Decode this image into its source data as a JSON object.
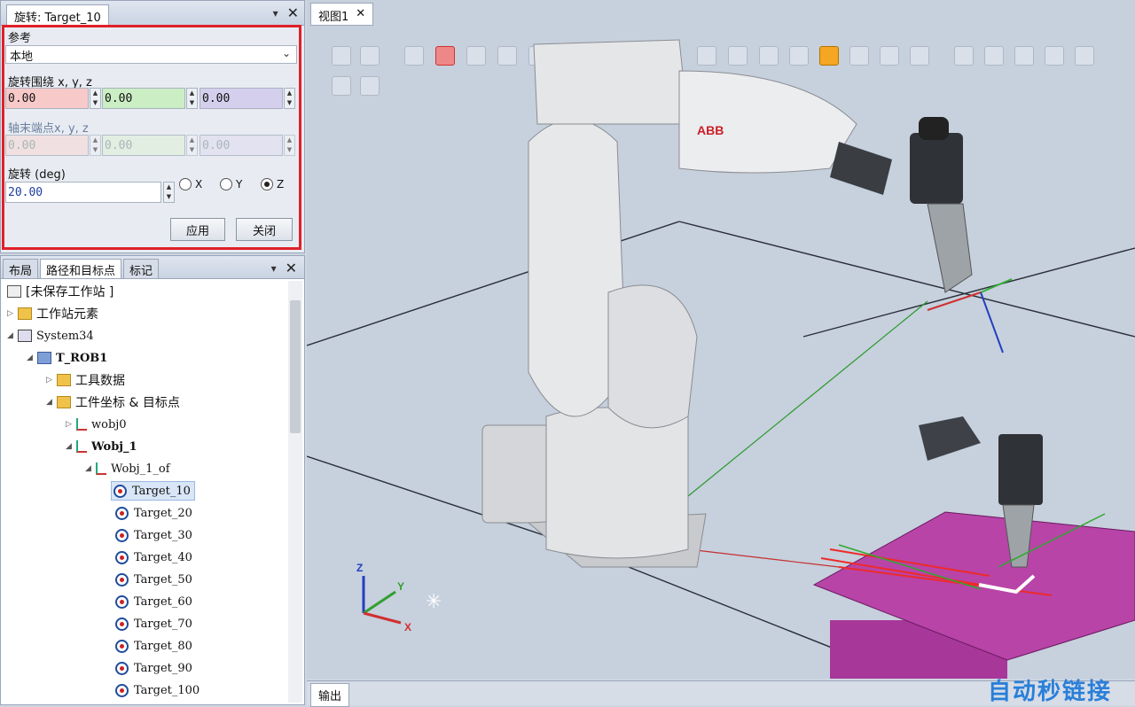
{
  "rotate_panel": {
    "title": "旋转: Target_10",
    "pin": "▾ ⊥",
    "reference_label": "参考",
    "reference_value": "本地",
    "rotate_around_label": "旋转围绕 x, y, z",
    "around_x": "0.00",
    "around_y": "0.00",
    "around_z": "0.00",
    "axis_end_label": "轴末端点x, y, z",
    "end_x": "0.00",
    "end_y": "0.00",
    "end_z": "0.00",
    "rotation_label": "旋转 (deg)",
    "rotation_value": "20.00",
    "radio_x": "X",
    "radio_y": "Y",
    "radio_z": "Z",
    "selected_axis": "Z",
    "apply_label": "应用",
    "close_label": "关闭"
  },
  "tree_panel": {
    "tabs": [
      "布局",
      "路径和目标点",
      "标记"
    ],
    "nodes": {
      "station": "[未保存工作站 ]",
      "station_elements": "工作站元素",
      "system": "System34",
      "task": "T_ROB1",
      "tool_data": "工具数据",
      "wobj_targets": "工件坐标 & 目标点",
      "wobj0": "wobj0",
      "wobj1": "Wobj_1",
      "wobj1_of": "Wobj_1_of"
    },
    "targets": [
      "Target_10",
      "Target_20",
      "Target_30",
      "Target_40",
      "Target_50",
      "Target_60",
      "Target_70",
      "Target_80",
      "Target_90",
      "Target_100"
    ]
  },
  "viewport": {
    "tab_label": "视图1",
    "robot_brand": "ABB",
    "axis_x": "X",
    "axis_y": "Y",
    "axis_z": "Z"
  },
  "output": {
    "tab_label": "输出"
  },
  "watermark": "自动秒链接"
}
